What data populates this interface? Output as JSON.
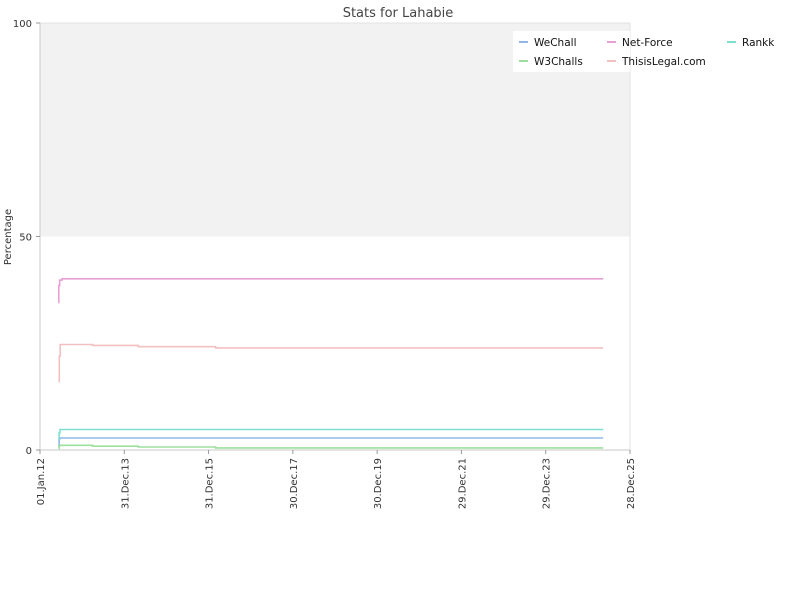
{
  "chart_data": {
    "type": "line",
    "title": "Stats for Lahabie",
    "xlabel": "",
    "ylabel": "Percentage",
    "ylim": [
      0,
      100
    ],
    "y_ticks": [
      "0",
      "50",
      "100"
    ],
    "x_ticks": [
      "01.Jan.12",
      "31.Dec.13",
      "31.Dec.15",
      "30.Dec.17",
      "30.Dec.19",
      "29.Dec.21",
      "29.Dec.23",
      "28.Dec.25"
    ],
    "x_tick_dates": [
      "2012-01-01",
      "2013-12-31",
      "2015-12-31",
      "2017-12-30",
      "2019-12-30",
      "2021-12-29",
      "2023-12-29",
      "2025-12-28"
    ],
    "xlim": [
      "2012-01-01",
      "2025-12-28"
    ],
    "grid": false,
    "shaded_band": [
      50,
      100
    ],
    "legend_position": "top-right",
    "series": [
      {
        "name": "WeChall",
        "color": "#8fb8e8",
        "points": [
          [
            "2012-06-12",
            0.5
          ],
          [
            "2012-06-14",
            2.5
          ],
          [
            "2012-06-20",
            2.8
          ],
          [
            "2025-05-10",
            2.8
          ]
        ]
      },
      {
        "name": "W3Challs",
        "color": "#9de09d",
        "points": [
          [
            "2012-06-12",
            0.3
          ],
          [
            "2012-06-14",
            1.0
          ],
          [
            "2012-06-25",
            1.1
          ],
          [
            "2013-04-01",
            0.9
          ],
          [
            "2014-05-01",
            0.7
          ],
          [
            "2016-03-01",
            0.5
          ],
          [
            "2025-05-10",
            0.5
          ]
        ]
      },
      {
        "name": "Net-Force",
        "color": "#e8a0d4",
        "points": [
          [
            "2012-06-10",
            34.5
          ],
          [
            "2012-06-12",
            38.5
          ],
          [
            "2012-06-20",
            39.8
          ],
          [
            "2012-07-10",
            40.1
          ],
          [
            "2025-05-10",
            40.1
          ]
        ]
      },
      {
        "name": "ThisisLegal.com",
        "color": "#f2c0c0",
        "points": [
          [
            "2012-06-12",
            16.0
          ],
          [
            "2012-06-16",
            22.0
          ],
          [
            "2012-06-24",
            24.7
          ],
          [
            "2013-04-01",
            24.5
          ],
          [
            "2014-05-01",
            24.2
          ],
          [
            "2016-03-01",
            23.9
          ],
          [
            "2025-05-10",
            23.9
          ]
        ]
      },
      {
        "name": "Rankk",
        "color": "#7fe0cf",
        "points": [
          [
            "2012-06-12",
            2.5
          ],
          [
            "2012-06-14",
            4.0
          ],
          [
            "2012-06-22",
            4.8
          ],
          [
            "2025-05-10",
            4.8
          ]
        ]
      }
    ]
  }
}
